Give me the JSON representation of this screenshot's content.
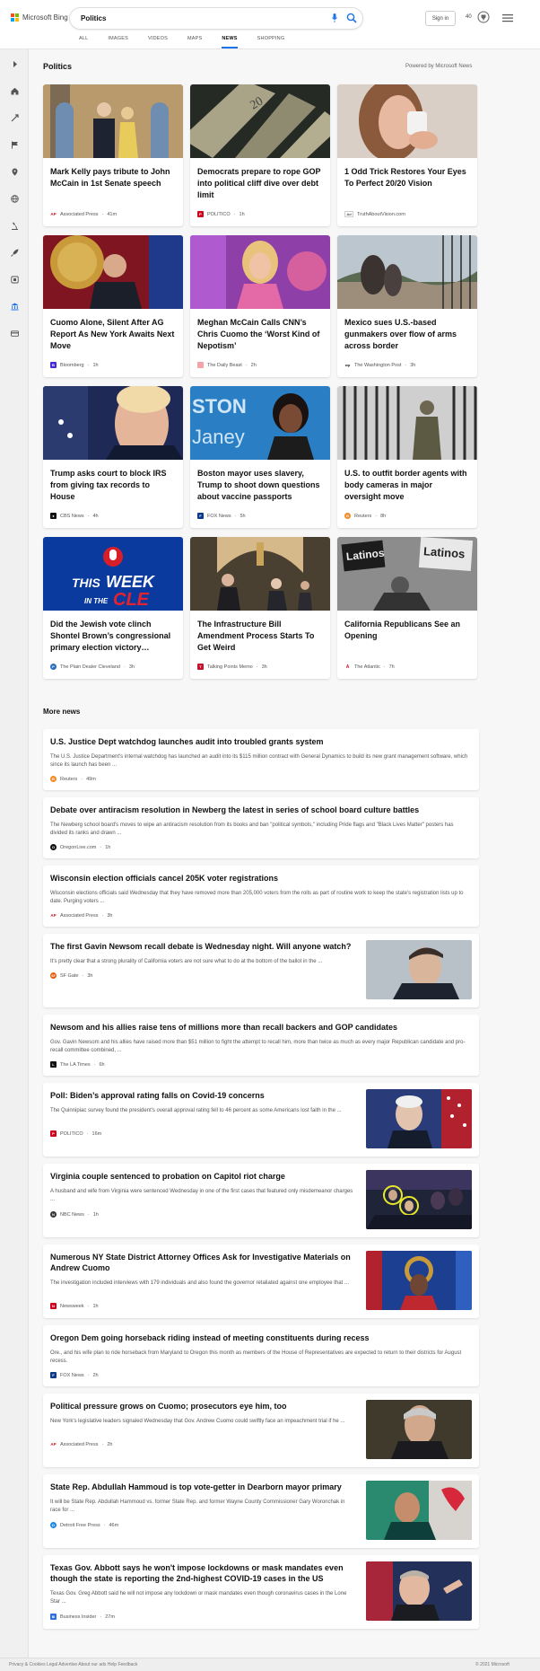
{
  "header": {
    "brand": "Microsoft Bing",
    "query": "Politics",
    "sign_in": "Sign in",
    "rewards_points": "40",
    "nav": [
      "ALL",
      "IMAGES",
      "VIDEOS",
      "MAPS",
      "NEWS",
      "SHOPPING"
    ],
    "active_tab": "NEWS"
  },
  "section": {
    "title": "Politics",
    "powered_by": "Powered by Microsoft News"
  },
  "cards": [
    {
      "title": "Mark Kelly pays tribute to John McCain in 1st Senate speech",
      "source": "Associated Press",
      "time": "41m",
      "icon_color": "#c4161c",
      "icon_label": "AP"
    },
    {
      "title": "Democrats prepare to rope GOP into political cliff dive over debt limit",
      "source": "POLITICO",
      "time": "1h",
      "icon_color": "#d0021b",
      "icon_label": "P"
    },
    {
      "title": "1 Odd Trick Restores Your Eyes To Perfect 20/20 Vision",
      "source": "TruthAboutVision.com",
      "time": "",
      "ad_label": "Ad",
      "icon_color": "#ffffff",
      "icon_label": "Ad"
    },
    {
      "title": "Cuomo Alone, Silent After AG Report As New York Awaits Next Move",
      "source": "Bloomberg",
      "time": "1h",
      "icon_color": "#472bd6",
      "icon_label": "B"
    },
    {
      "title": "Meghan McCain Calls CNN’s Chris Cuomo the ‘Worst Kind of Nepotism’",
      "source": "The Daily Beast",
      "time": "2h",
      "icon_color": "#f4a3a8",
      "icon_label": ""
    },
    {
      "title": "Mexico sues U.S.-based gunmakers over flow of arms across border",
      "source": "The Washington Post",
      "time": "3h",
      "icon_color": "#222222",
      "icon_label": "wp"
    },
    {
      "title": "Trump asks court to block IRS from giving tax records to House",
      "source": "CBS News",
      "time": "4h",
      "icon_color": "#111111",
      "icon_label": "●"
    },
    {
      "title": "Boston mayor uses slavery, Trump to shoot down questions about vaccine passports",
      "source": "FOX News",
      "time": "5h",
      "icon_color": "#0a3a8c",
      "icon_label": "F"
    },
    {
      "title": "U.S. to outfit border agents with body cameras in major oversight move",
      "source": "Reuters",
      "time": "8h",
      "icon_color": "#f28c28",
      "icon_label": "R"
    },
    {
      "title": "Did the Jewish vote clinch Shontel Brown’s congressional primary election victory…",
      "source": "The Plain Dealer Cleveland",
      "time": "3h",
      "icon_color": "#2a6ebb",
      "icon_label": "P"
    },
    {
      "title": "The Infrastructure Bill Amendment Process Starts To Get Weird",
      "source": "Talking Points Memo",
      "time": "3h",
      "icon_color": "#c8102e",
      "icon_label": "T"
    },
    {
      "title": "California Republicans See an Opening",
      "source": "The Atlantic",
      "time": "7h",
      "icon_color": "#ffffff",
      "icon_label": "A"
    }
  ],
  "more_news": {
    "title": "More news",
    "items": [
      {
        "title": "U.S. Justice Dept watchdog launches audit into troubled grants system",
        "snippet": "The U.S. Justice Department's internal watchdog has launched an audit into its $115 million contract with General Dynamics to build its new grant management software, which since its launch has been ...",
        "source": "Reuters",
        "time": "49m",
        "icon_color": "#f28c28",
        "icon_label": "R"
      },
      {
        "title": "Debate over antiracism resolution in Newberg the latest in series of school board culture battles",
        "snippet": "The Newberg school board's moves to wipe an antiracism resolution from its books and ban \"political symbols,\" including Pride flags and \"Black Lives Matter\" posters has divided its ranks and drawn ...",
        "source": "OregonLive.com",
        "time": "1h",
        "icon_color": "#111111",
        "icon_label": "O"
      },
      {
        "title": "Wisconsin election officials cancel 205K voter registrations",
        "snippet": "Wisconsin elections officials said Wednesday that they have removed more than 205,000 voters from the rolls as part of routine work to keep the state's registration lists up to date. Purging voters ...",
        "source": "Associated Press",
        "time": "3h",
        "icon_color": "#c4161c",
        "icon_label": "AP"
      },
      {
        "title": "The first Gavin Newsom recall debate is Wednesday night. Will anyone watch?",
        "snippet": "It's pretty clear that a strong plurality of California voters are not sure what to do at the bottom of the ballot in the ...",
        "source": "SF Gate",
        "time": "3h",
        "icon_color": "#e85d0c",
        "icon_label": "SF"
      },
      {
        "title": "Newsom and his allies raise tens of millions more than recall backers and GOP candidates",
        "snippet": "Gov. Gavin Newsom and his allies have raised more than $51 million to fight the attempt to recall him, more than twice as much as every major Republican candidate and pro-recall committee combined, ...",
        "source": "The LA Times",
        "time": "6h",
        "icon_color": "#111111",
        "icon_label": "L"
      },
      {
        "title": "Poll: Biden’s approval rating falls on Covid-19 concerns",
        "snippet": "The Quinnipiac survey found the president's overall approval rating fell to 46 percent as some Americans lost faith in the ...",
        "source": "POLITICO",
        "time": "16m",
        "icon_color": "#d0021b",
        "icon_label": "P"
      },
      {
        "title": "Virginia couple sentenced to probation on Capitol riot charge",
        "snippet": "A husband and wife from Virginia were sentenced Wednesday in one of the first cases that featured only misdemeanor charges ...",
        "source": "NBC News",
        "time": "1h",
        "icon_color": "#333333",
        "icon_label": "N"
      },
      {
        "title": "Numerous NY State District Attorney Offices Ask for Investigative Materials on Andrew Cuomo",
        "snippet": "The investigation included interviews with 179 individuals and also found the governor retaliated against one employee that ...",
        "source": "Newsweek",
        "time": "1h",
        "icon_color": "#d0021b",
        "icon_label": "N"
      },
      {
        "title": "Oregon Dem going horseback riding instead of meeting constituents during recess",
        "snippet": "Ore., and his wife plan to ride horseback from Maryland to Oregon this month as members of the House of Representatives are expected to return to their districts for August recess.",
        "source": "FOX News",
        "time": "2h",
        "icon_color": "#0a3a8c",
        "icon_label": "F"
      },
      {
        "title": "Political pressure grows on Cuomo; prosecutors eye him, too",
        "snippet": "New York's legislative leaders signaled Wednesday that Gov. Andrew Cuomo could swiftly face an impeachment trial if he ...",
        "source": "Associated Press",
        "time": "2h",
        "icon_color": "#c4161c",
        "icon_label": "AP"
      },
      {
        "title": "State Rep. Abdullah Hammoud is top vote-getter in Dearborn mayor primary",
        "snippet": "It will be State Rep. Abdullah Hammoud vs. former State Rep. and former Wayne County Commissioner Gary Woronchak in race for ...",
        "source": "Detroit Free Press",
        "time": "46m",
        "icon_color": "#1e88e5",
        "icon_label": "D"
      },
      {
        "title": "Texas Gov. Abbott says he won't impose lockdowns or mask mandates even though the state is reporting the 2nd-highest COVID-19 cases in the US",
        "snippet": "Texas Gov. Greg Abbott said he will not impose any lockdown or mask mandates even though coronavirus cases in the Lone Star ...",
        "source": "Business Insider",
        "time": "27m",
        "icon_color": "#2f6fdf",
        "icon_label": "BI"
      }
    ]
  },
  "footer": {
    "left": "Privacy & Cookies   Legal   Advertise   About our ads   Help   Feedback",
    "right": "© 2021 Microsoft"
  },
  "colors": {
    "accent": "#1a73e8",
    "sidebar_bg": "#f0f0f0",
    "page_bg": "#f7f7f7"
  },
  "sidebar_icons": [
    "chevron-right-icon",
    "home-icon",
    "sparkle-icon",
    "flag-icon",
    "location-icon",
    "globe-icon",
    "microscope-icon",
    "rocket-icon",
    "film-icon",
    "bank-icon",
    "card-icon"
  ]
}
